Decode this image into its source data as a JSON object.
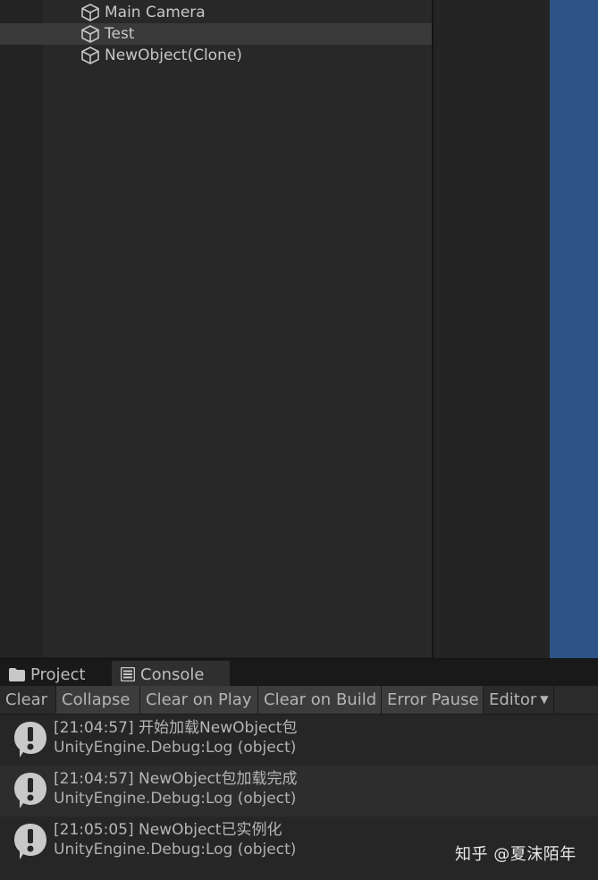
{
  "hierarchy": {
    "items": [
      {
        "label": "Main Camera",
        "icon": "cube-icon",
        "selected": false
      },
      {
        "label": "Test",
        "icon": "cube-icon",
        "selected": true
      },
      {
        "label": "NewObject(Clone)",
        "icon": "cube-icon",
        "selected": false
      }
    ]
  },
  "tabs": {
    "project": {
      "label": "Project",
      "icon": "folder-icon"
    },
    "console": {
      "label": "Console",
      "icon": "console-icon",
      "active": true
    }
  },
  "toolbar": {
    "clear": "Clear",
    "collapse": "Collapse",
    "clear_on_play": "Clear on Play",
    "clear_on_build": "Clear on Build",
    "error_pause": "Error Pause",
    "editor": "Editor"
  },
  "console": {
    "entries": [
      {
        "message": "[21:04:57] 开始加载NewObject包",
        "source": "UnityEngine.Debug:Log (object)",
        "icon": "warning-icon"
      },
      {
        "message": "[21:04:57] NewObject包加载完成",
        "source": "UnityEngine.Debug:Log (object)",
        "icon": "warning-icon"
      },
      {
        "message": "[21:05:05] NewObject已实例化",
        "source": "UnityEngine.Debug:Log (object)",
        "icon": "warning-icon"
      }
    ]
  },
  "watermark": {
    "text": "知乎 @夏沫陌年"
  },
  "colors": {
    "panel": "#282828",
    "selected_row": "#3a3a3a",
    "scene_sky": "#2e5487",
    "text": "#c4c4c4"
  }
}
